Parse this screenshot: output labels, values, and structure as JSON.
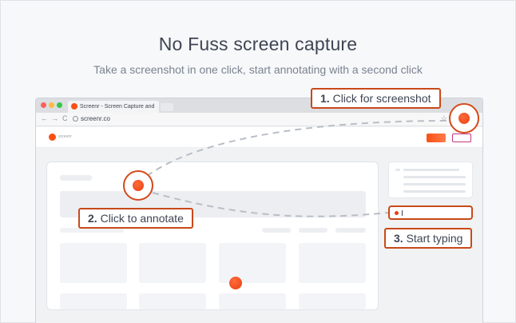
{
  "hero": {
    "title": "No Fuss screen capture",
    "subtitle": "Take a screenshot in one click, start annotating with a second click"
  },
  "browser": {
    "tab_title": "Screenr - Screen Capture and",
    "url": "screenr.co",
    "nav": {
      "back": "←",
      "forward": "→",
      "reload": "C",
      "star": "☆"
    }
  },
  "app": {
    "logo_text": "screenr"
  },
  "steps": [
    {
      "number": "1.",
      "label": "Click for screenshot"
    },
    {
      "number": "2.",
      "label": "Click to annotate"
    },
    {
      "number": "3.",
      "label": "Start typing"
    }
  ],
  "colors": {
    "accent": "#fb4f14",
    "callout_border": "#c9491a",
    "text": "#3e4553"
  },
  "icons": [
    "screenr-logo-icon",
    "info-icon",
    "star-icon"
  ]
}
